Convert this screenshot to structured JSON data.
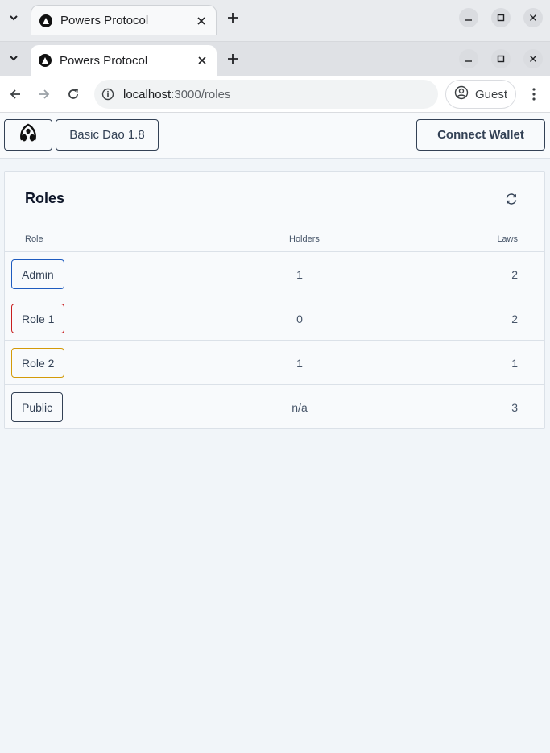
{
  "browser": {
    "tab_title": "Powers Protocol",
    "url_host": "localhost",
    "url_path": ":3000/roles",
    "profile_label": "Guest"
  },
  "header": {
    "dao_label": "Basic Dao 1.8",
    "connect_label": "Connect Wallet"
  },
  "roles_card": {
    "title": "Roles",
    "columns": {
      "role": "Role",
      "holders": "Holders",
      "laws": "Laws"
    },
    "rows": [
      {
        "role": "Admin",
        "holders": "1",
        "laws": "2",
        "color": "#1e5bbf"
      },
      {
        "role": "Role 1",
        "holders": "0",
        "laws": "2",
        "color": "#c81e1e"
      },
      {
        "role": "Role 2",
        "holders": "1",
        "laws": "1",
        "color": "#d39a08"
      },
      {
        "role": "Public",
        "holders": "n/a",
        "laws": "3",
        "color": "#334155"
      }
    ]
  },
  "icons": {
    "tab_menu": "chevron-down-icon",
    "favicon": "triangle-logo-icon",
    "close": "close-icon",
    "new_tab": "plus-icon",
    "back": "arrow-left-icon",
    "forward": "arrow-right-icon",
    "reload": "reload-icon",
    "info": "info-icon",
    "profile": "person-icon",
    "menu": "kebab-icon",
    "refresh": "refresh-icon"
  }
}
